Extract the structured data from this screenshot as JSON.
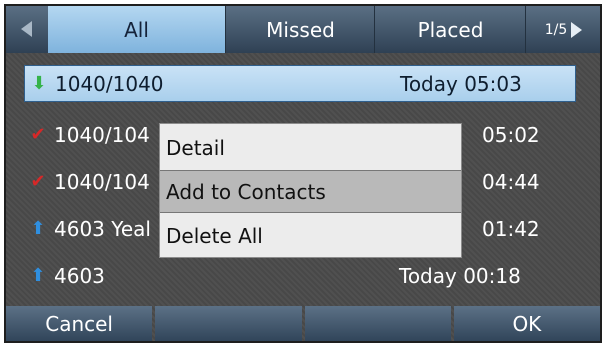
{
  "tabs": {
    "all": "All",
    "missed": "Missed",
    "placed": "Placed",
    "page_indicator": "1/5"
  },
  "calls": [
    {
      "icon": "incoming-call-icon",
      "name": "1040/1040",
      "time": "Today 05:03",
      "selected": true
    },
    {
      "icon": "missed-call-icon",
      "name": "1040/104",
      "time": "05:02"
    },
    {
      "icon": "missed-call-icon",
      "name": "1040/104",
      "time": "04:44"
    },
    {
      "icon": "outgoing-call-icon",
      "name": "4603 Yeal",
      "time": "01:42"
    },
    {
      "icon": "outgoing-call-icon",
      "name": "4603",
      "time": "Today 00:18"
    }
  ],
  "menu": {
    "items": [
      "Detail",
      "Add to Contacts",
      "Delete All"
    ],
    "highlighted_index": 1
  },
  "softkeys": [
    "Cancel",
    "",
    "",
    "OK"
  ],
  "colors": {
    "tab_active": "#9fc8ea",
    "row_selected": "#b8d8f1",
    "incoming": "#35b34a",
    "missed": "#d62828",
    "outgoing": "#2f8fe0"
  }
}
